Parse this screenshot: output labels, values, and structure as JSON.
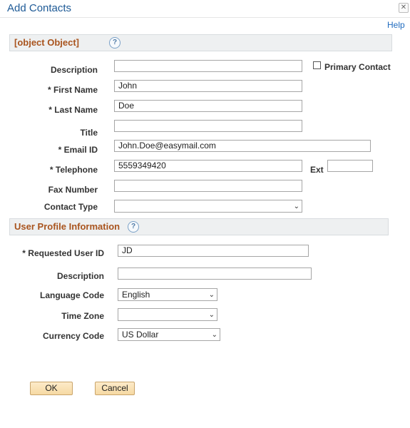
{
  "window": {
    "title": "Add Contacts",
    "close_glyph": "✕"
  },
  "help": {
    "label": "Help"
  },
  "contact_section": {
    "title": {
      "label": "Title",
      "value": ""
    },
    "help_icon": "?",
    "description": {
      "label": "Description",
      "value": ""
    },
    "primary_contact": {
      "label": "Primary Contact",
      "checked": false
    },
    "first_name": {
      "label": "* First Name",
      "value": "John"
    },
    "last_name": {
      "label": "* Last Name",
      "value": "Doe"
    },
    "email": {
      "label": "* Email ID",
      "value": "John.Doe@easymail.com"
    },
    "telephone": {
      "label": "* Telephone",
      "value": "5559349420"
    },
    "ext": {
      "label": "Ext",
      "value": ""
    },
    "fax": {
      "label": "Fax Number",
      "value": ""
    },
    "contact_type": {
      "label": "Contact Type",
      "value": ""
    }
  },
  "profile_section": {
    "title": "User Profile Information",
    "help_icon": "?",
    "requested_user_id": {
      "label": "* Requested User ID",
      "value": "JD"
    },
    "description": {
      "label": "Description",
      "value": ""
    },
    "language_code": {
      "label": "Language Code",
      "value": "English"
    },
    "time_zone": {
      "label": "Time Zone",
      "value": ""
    },
    "currency_code": {
      "label": "Currency Code",
      "value": "US Dollar"
    }
  },
  "buttons": {
    "ok": "OK",
    "cancel": "Cancel"
  },
  "colors": {
    "title": "#1e5a96",
    "section_title": "#a9541e",
    "button_bg": "#f6d9a3",
    "link": "#1f6bbf"
  }
}
